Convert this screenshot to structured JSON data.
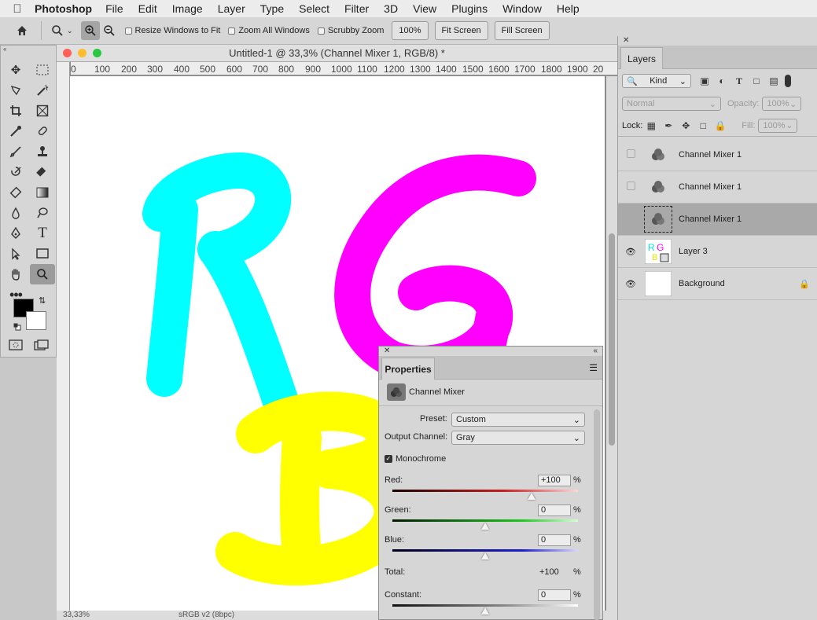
{
  "menubar": {
    "app": "Photoshop",
    "items": [
      "File",
      "Edit",
      "Image",
      "Layer",
      "Type",
      "Select",
      "Filter",
      "3D",
      "View",
      "Plugins",
      "Window",
      "Help"
    ]
  },
  "options": {
    "resize_windows": "Resize Windows to Fit",
    "zoom_all": "Zoom All Windows",
    "scrubby_zoom": "Scrubby Zoom",
    "zoom_level": "100%",
    "fit_screen": "Fit Screen",
    "fill_screen": "Fill Screen"
  },
  "document": {
    "title": "Untitled-1 @ 33,3% (Channel Mixer 1, RGB/8) *",
    "ruler_ticks": [
      "0",
      "100",
      "200",
      "300",
      "400",
      "500",
      "600",
      "700",
      "800",
      "900",
      "1000",
      "1100",
      "1200",
      "1300",
      "1400",
      "1500",
      "1600",
      "1700",
      "1800",
      "1900",
      "20"
    ],
    "status_zoom": "33,33%",
    "status_profile": "sRGB v2 (8bpc)",
    "letters": [
      "R",
      "G",
      "B"
    ]
  },
  "layers_panel": {
    "tab": "Layers",
    "filter_kind": "Kind",
    "blend_mode": "Normal",
    "opacity_label": "Opacity:",
    "opacity_value": "100%",
    "lock_label": "Lock:",
    "fill_label": "Fill:",
    "fill_value": "100%",
    "layers": [
      {
        "name": "Channel Mixer 1",
        "visible": false,
        "selected": false
      },
      {
        "name": "Channel Mixer 1",
        "visible": false,
        "selected": false
      },
      {
        "name": "Channel Mixer 1",
        "visible": false,
        "selected": true
      },
      {
        "name": "Layer 3",
        "visible": true,
        "selected": false
      },
      {
        "name": "Background",
        "visible": true,
        "selected": false,
        "locked": true
      }
    ]
  },
  "properties": {
    "tab": "Properties",
    "adjustment": "Channel Mixer",
    "preset_label": "Preset:",
    "preset_value": "Custom",
    "output_label": "Output Channel:",
    "output_value": "Gray",
    "monochrome_label": "Monochrome",
    "monochrome_checked": true,
    "red_label": "Red:",
    "red_value": "+100",
    "green_label": "Green:",
    "green_value": "0",
    "blue_label": "Blue:",
    "blue_value": "0",
    "total_label": "Total:",
    "total_value": "+100",
    "constant_label": "Constant:",
    "constant_value": "0",
    "percent": "%"
  },
  "colors": {
    "cyan": "#00ffff",
    "magenta": "#ff00ff",
    "yellow": "#ffff00",
    "selected_row": "#a9a9a9"
  }
}
